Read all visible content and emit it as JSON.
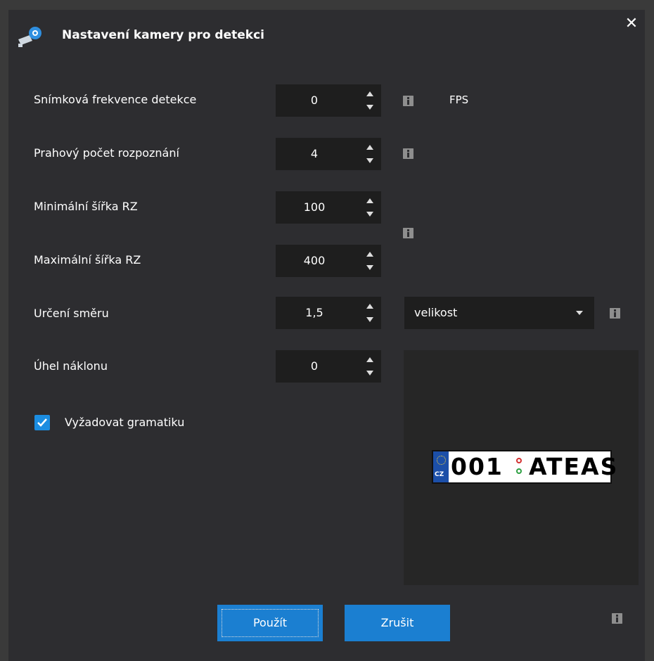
{
  "dialog": {
    "title": "Nastavení kamery pro detekci",
    "close_label": "✕"
  },
  "fields": {
    "fps": {
      "label": "Snímková frekvence detekce",
      "value": "0",
      "unit": "FPS"
    },
    "threshold": {
      "label": "Prahový počet rozpoznání",
      "value": "4"
    },
    "min_width": {
      "label": "Minimální šířka RZ",
      "value": "100"
    },
    "max_width": {
      "label": "Maximální šířka RZ",
      "value": "400"
    },
    "direction": {
      "label": "Určení směru",
      "value": "1,5",
      "mode_selected": "velikost"
    },
    "tilt": {
      "label": "Úhel náklonu",
      "value": "0"
    }
  },
  "grammar": {
    "label": "Vyžadovat gramatiku",
    "checked": true
  },
  "preview": {
    "plate_country": "CZ",
    "plate_left": "001",
    "plate_right": "ATEAS"
  },
  "buttons": {
    "apply": "Použít",
    "cancel": "Zrušit"
  },
  "colors": {
    "accent": "#1b7fd1",
    "checkbox": "#1b8de1",
    "background": "#2d2d30",
    "input_background": "#1e1e1e",
    "info_icon": "#8e8e8e"
  },
  "icons": {
    "title": "camera-settings-icon",
    "close": "close-icon",
    "spin": "spin-arrows-icon",
    "info": "info-icon",
    "dropdown": "chevron-down-icon",
    "check": "checkmark-icon"
  }
}
